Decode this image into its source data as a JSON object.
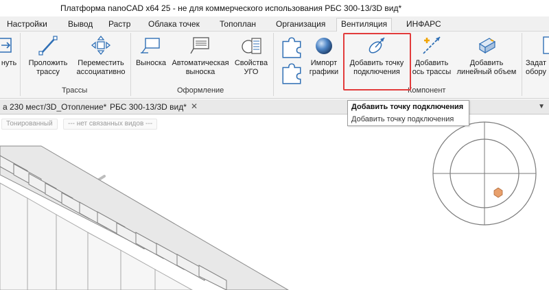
{
  "window": {
    "title": "Платформа nanoCAD x64 25 - не для коммерческого использования РБС 300-13/3D вид*"
  },
  "tabs": [
    {
      "label": "Настройки"
    },
    {
      "label": "Вывод"
    },
    {
      "label": "Растр"
    },
    {
      "label": "Облака точек"
    },
    {
      "label": "Топоплан"
    },
    {
      "label": "Организация"
    },
    {
      "label": "Вентиляция",
      "active": true
    },
    {
      "label": "ИНФАРС"
    }
  ],
  "ribbon": {
    "partial_left": {
      "label": "нуть"
    },
    "groups": {
      "trassy": {
        "label": "Трассы"
      },
      "oformlenie": {
        "label": "Оформление"
      },
      "komponent": {
        "label": "Компонент"
      }
    },
    "buttons": {
      "route": {
        "line1": "Проложить",
        "line2": "трассу",
        "icon": "pen-line-icon"
      },
      "move": {
        "line1": "Переместить",
        "line2": "ассоциативно",
        "icon": "move-arrows-icon"
      },
      "leader": {
        "line1": "Выноска",
        "icon": "leader-icon"
      },
      "auto_leader": {
        "line1": "Автоматическая",
        "line2": "выноска",
        "icon": "auto-leader-icon"
      },
      "ugo": {
        "line1": "Свойства",
        "line2": "УГО",
        "icon": "ugo-properties-icon"
      },
      "import": {
        "line1": "Импорт",
        "line2": "графики",
        "icon": "puzzle-import-icon"
      },
      "add_point": {
        "line1": "Добавить точку",
        "line2": "подключения",
        "icon": "connection-point-icon"
      },
      "add_axis": {
        "line1": "Добавить",
        "line2": "ось трассы",
        "icon": "route-axis-icon"
      },
      "add_volume": {
        "line1": "Добавить",
        "line2": "линейный объем",
        "icon": "linear-volume-icon"
      },
      "partial_right": {
        "line1": "Задат",
        "line2": "обору"
      }
    }
  },
  "doc_tabs": [
    {
      "label": "а 230 мест/3D_Отопление*"
    },
    {
      "label": "РБС 300-13/3D вид*"
    }
  ],
  "viewport": {
    "chips": [
      "Тонированный",
      "--- нет связанных видов ---"
    ]
  },
  "tooltip": {
    "title": "Добавить точку подключения",
    "description": "Добавить точку подключения"
  },
  "colors": {
    "highlight": "#e23b3b",
    "accent_blue": "#2f6fb5",
    "marker": "#e8a06c"
  }
}
